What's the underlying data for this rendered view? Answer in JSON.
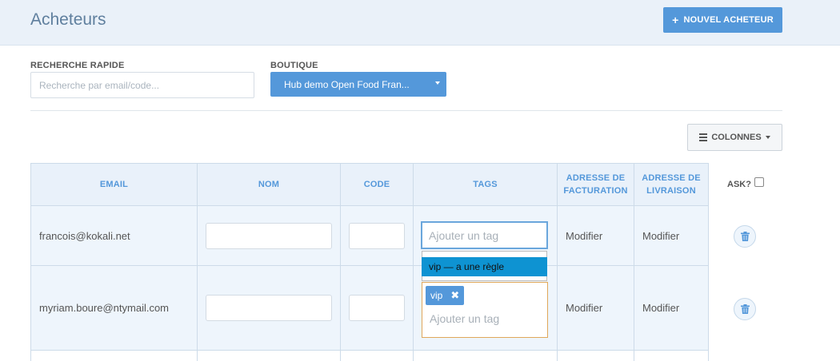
{
  "header": {
    "title": "Acheteurs",
    "new_button_icon": "plus-icon",
    "new_button_label": "NOUVEL ACHETEUR"
  },
  "filters": {
    "search_label": "RECHERCHE RAPIDE",
    "search_placeholder": "Recherche par email/code...",
    "shop_label": "BOUTIQUE",
    "shop_value": "Hub demo Open Food Fran..."
  },
  "columns_button": {
    "label": "COLONNES",
    "icon": "list-icon"
  },
  "table": {
    "headers": {
      "email": "EMAIL",
      "name": "NOM",
      "code": "CODE",
      "tags": "TAGS",
      "billing": "ADRESSE DE FACTURATION",
      "shipping": "ADRESSE DE LIVRAISON"
    },
    "ask_label": "ASK?",
    "rows": [
      {
        "email": "francois@kokali.net",
        "name": "",
        "code": "",
        "tags": [],
        "tag_placeholder": "Ajouter un tag",
        "billing_link": "Modifier",
        "shipping_link": "Modifier",
        "delete_icon": "trash-icon"
      },
      {
        "email": "myriam.boure@ntymail.com",
        "name": "",
        "code": "",
        "tags": [
          "vip"
        ],
        "tag_placeholder": "Ajouter un tag",
        "billing_link": "Modifier",
        "shipping_link": "Modifier",
        "delete_icon": "trash-icon"
      }
    ]
  },
  "tag_suggestion": "vip — a une règle",
  "colors": {
    "accent": "#5498da",
    "header_bg": "#eaf1f9",
    "row_bg": "#eef5fc",
    "suggestion_bg": "#0e93d2"
  }
}
